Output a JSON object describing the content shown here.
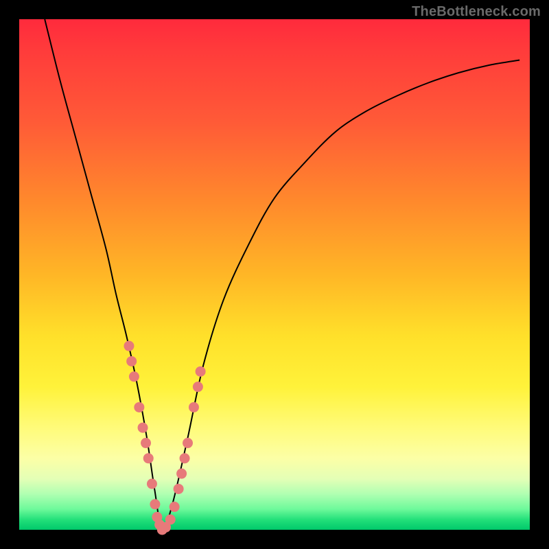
{
  "watermark": "TheBottleneck.com",
  "chart_data": {
    "type": "line",
    "title": "",
    "xlabel": "",
    "ylabel": "",
    "xlim": [
      0,
      100
    ],
    "ylim": [
      0,
      100
    ],
    "grid": false,
    "series": [
      {
        "name": "bottleneck-curve",
        "x": [
          5,
          8,
          11,
          14,
          17,
          19,
          21,
          23,
          25,
          26.5,
          28,
          30,
          33,
          36,
          40,
          45,
          50,
          56,
          62,
          68,
          74,
          80,
          86,
          92,
          98
        ],
        "y": [
          100,
          88,
          77,
          66,
          55,
          46,
          38,
          29,
          18,
          8,
          0,
          5,
          18,
          32,
          45,
          56,
          65,
          72,
          78,
          82,
          85,
          87.5,
          89.5,
          91,
          92
        ]
      }
    ],
    "points": {
      "name": "highlight-dots",
      "color": "#e77a7a",
      "xy": [
        [
          21.5,
          36
        ],
        [
          22.0,
          33
        ],
        [
          22.5,
          30
        ],
        [
          23.5,
          24
        ],
        [
          24.2,
          20
        ],
        [
          24.8,
          17
        ],
        [
          25.3,
          14
        ],
        [
          26.0,
          9
        ],
        [
          26.6,
          5
        ],
        [
          27.0,
          2.5
        ],
        [
          27.5,
          1
        ],
        [
          28.0,
          0
        ],
        [
          28.7,
          0.5
        ],
        [
          29.6,
          2
        ],
        [
          30.4,
          4.5
        ],
        [
          31.2,
          8
        ],
        [
          31.8,
          11
        ],
        [
          32.4,
          14
        ],
        [
          33.0,
          17
        ],
        [
          34.2,
          24
        ],
        [
          35.0,
          28
        ],
        [
          35.5,
          31
        ]
      ]
    },
    "background_gradient": {
      "top": "#ff2a3c",
      "mid": "#ffe02a",
      "bottom": "#00c86a"
    }
  }
}
